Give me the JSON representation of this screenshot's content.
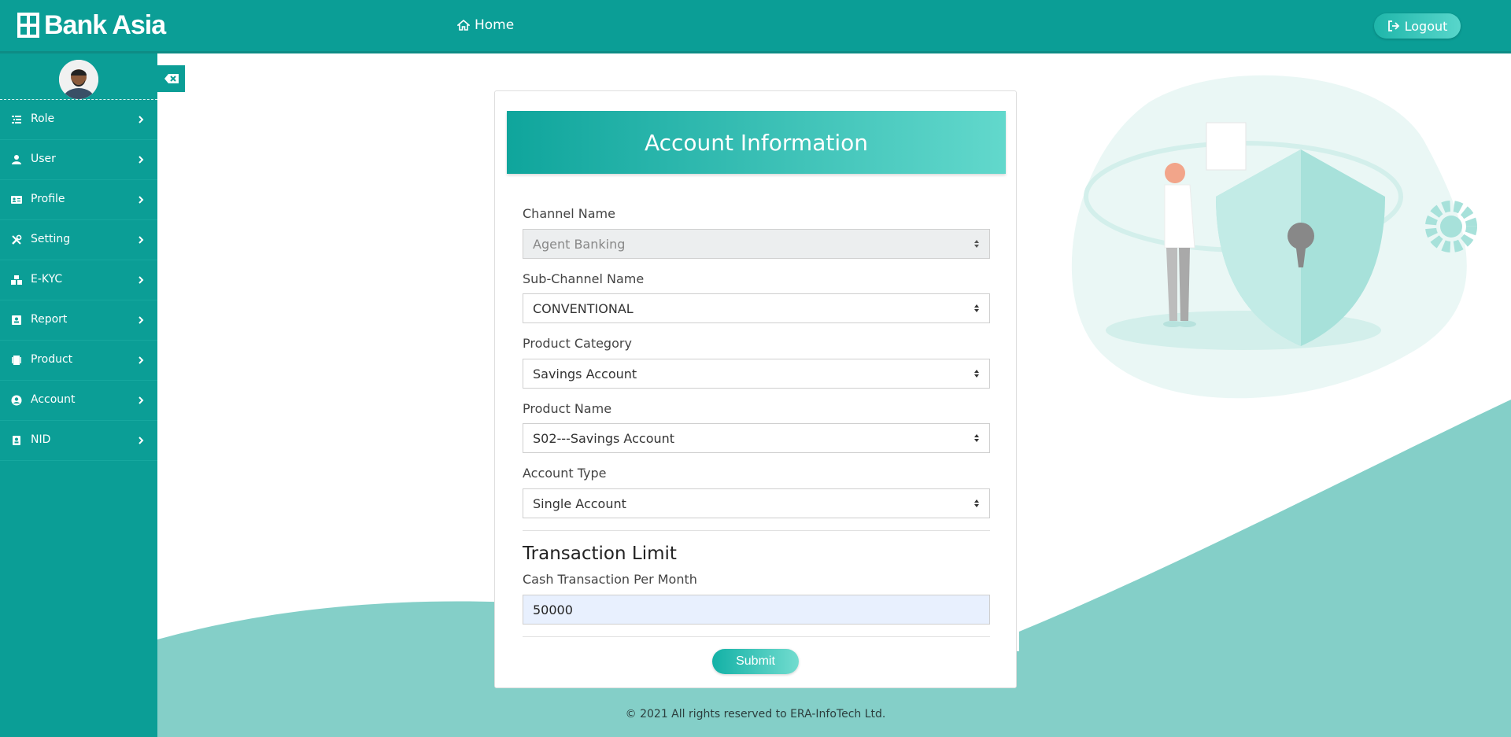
{
  "brand": {
    "name": "Bank Asia"
  },
  "header": {
    "home_label": "Home",
    "logout_label": "Logout"
  },
  "colors": {
    "primary": "#0b9e96",
    "accent": "#62d8cc",
    "wave": "#84cfc8"
  },
  "sidebar": {
    "items": [
      {
        "label": "Role",
        "icon": "list-icon"
      },
      {
        "label": "User",
        "icon": "user-icon"
      },
      {
        "label": "Profile",
        "icon": "id-card-icon"
      },
      {
        "label": "Setting",
        "icon": "tools-icon"
      },
      {
        "label": "E-KYC",
        "icon": "cubes-icon"
      },
      {
        "label": "Report",
        "icon": "report-icon"
      },
      {
        "label": "Product",
        "icon": "product-icon"
      },
      {
        "label": "Account",
        "icon": "user-circle-icon"
      },
      {
        "label": "NID",
        "icon": "id-badge-icon"
      }
    ]
  },
  "form": {
    "title": "Account Information",
    "channel_name": {
      "label": "Channel Name",
      "value": "Agent Banking",
      "disabled": true
    },
    "sub_channel_name": {
      "label": "Sub-Channel Name",
      "value": "CONVENTIONAL"
    },
    "product_category": {
      "label": "Product Category",
      "value": "Savings Account"
    },
    "product_name": {
      "label": "Product Name",
      "value": "S02---Savings Account"
    },
    "account_type": {
      "label": "Account Type",
      "value": "Single Account"
    },
    "transaction_limit": {
      "title": "Transaction Limit",
      "cash_per_month_label": "Cash Transaction Per Month",
      "cash_per_month_value": "50000"
    },
    "submit_label": "Submit"
  },
  "footer": {
    "text": "© 2021 All rights reserved to ERA-InfoTech Ltd."
  }
}
